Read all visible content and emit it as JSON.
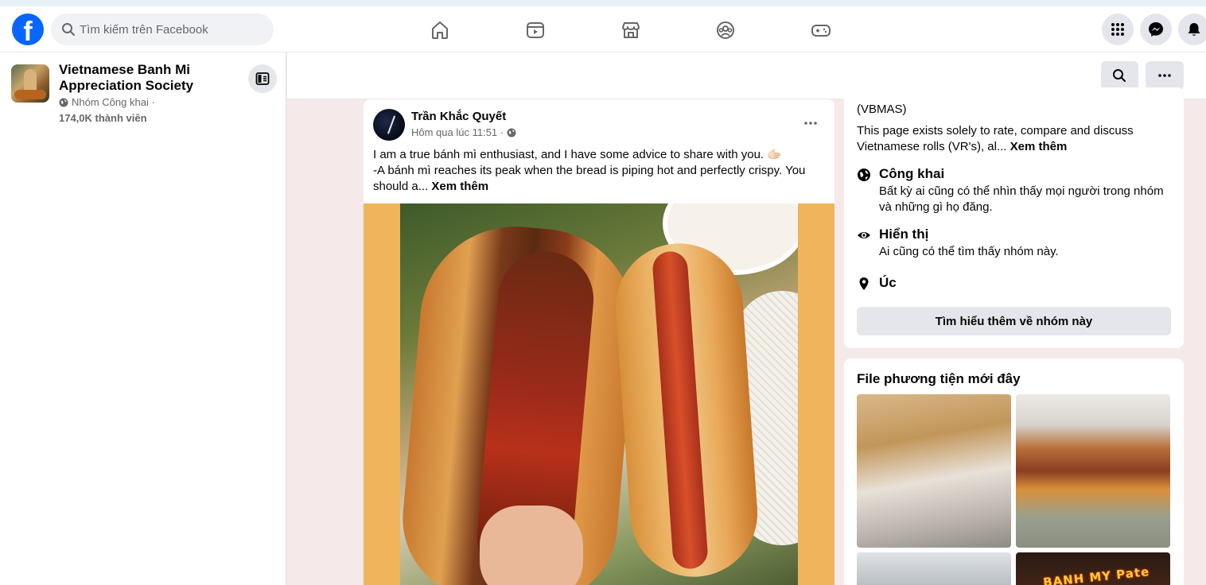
{
  "topnav": {
    "logo_text": "f",
    "search": {
      "placeholder": "Tìm kiếm trên Facebook"
    },
    "center_icons": [
      "home-icon",
      "video-icon",
      "marketplace-icon",
      "groups-icon",
      "gaming-icon"
    ],
    "right_icons": [
      "menu-grid-icon",
      "messenger-icon",
      "notifications-icon"
    ]
  },
  "group": {
    "name": "Vietnamese Banh Mi Appreciation Society",
    "privacy": "Nhóm Công khai ·",
    "members": "174,0K thành viên"
  },
  "post": {
    "author": "Trần Khắc Quyết",
    "time": "Hôm qua lúc 11:51 ·",
    "line1": "I am a true bánh mì enthusiast, and I have some advice to share with you. 🫱🏻",
    "line2": "-A bánh mì reaches its peak when the bread is piping hot and perfectly crispy. You should a...",
    "see_more": "Xem thêm"
  },
  "about": {
    "abbr": "(VBMAS)",
    "desc": "This page exists solely to rate, compare and discuss Vietnamese rolls (VR's), al...",
    "see_more": "Xem thêm",
    "public_title": "Công khai",
    "public_desc": "Bất kỳ ai cũng có thể nhìn thấy mọi người trong nhóm và những gì họ đăng.",
    "visible_title": "Hiển thị",
    "visible_desc": "Ai cũng có thể tìm thấy nhóm này.",
    "location": "Úc",
    "learn_more": "Tìm hiểu thêm về nhóm này"
  },
  "media": {
    "title": "File phương tiện mới đây",
    "sign_text": "BANH MY Pate"
  },
  "colors": {
    "brand": "#0866ff",
    "background": "#f5e9e9",
    "media_backdrop": "#f0b45c"
  }
}
